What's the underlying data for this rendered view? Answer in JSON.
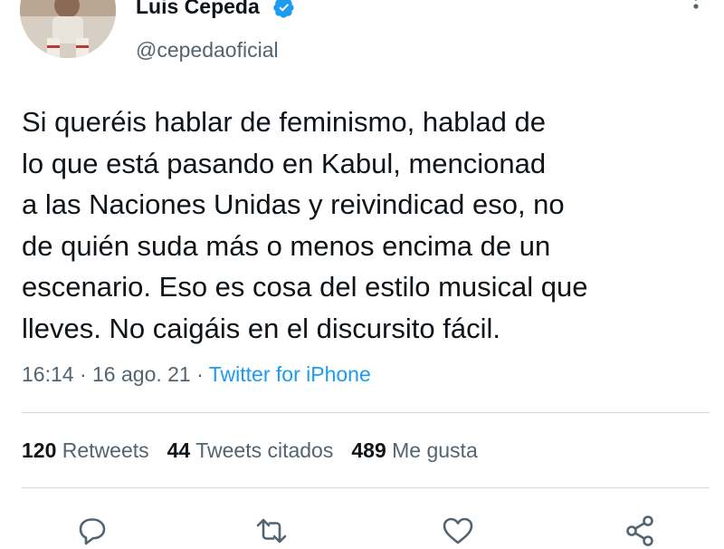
{
  "user": {
    "display_name": "Luis Cepeda",
    "handle": "@cepedaoficial",
    "avatar_icon": "profile-photo",
    "verified_icon": "verified-badge-icon",
    "verified_color": "#1d9bf0"
  },
  "tweet": {
    "lines": [
      "Si queréis hablar de feminismo, hablad de",
      "lo que está pasando en Kabul, mencionad",
      "a las Naciones Unidas y reivindicad eso, no",
      "de quién suda más o menos encima de un",
      "escenario. Eso es cosa del estilo musical que",
      "lleves. No caigáis en el discursito fácil."
    ],
    "time": "16:14",
    "sep1": "·",
    "date": "16 ago. 21",
    "sep2": "·",
    "source": "Twitter for iPhone"
  },
  "stats": {
    "retweets_count": "120",
    "retweets_label": "Retweets",
    "quotes_count": "44",
    "quotes_label": "Tweets citados",
    "likes_count": "489",
    "likes_label": "Me gusta"
  },
  "actions": [
    "reply-icon",
    "retweet-icon",
    "like-icon",
    "share-icon"
  ],
  "colors": {
    "text": "#0f1419",
    "secondary": "#536471",
    "link": "#1d9bf0",
    "divider": "#cfd9de"
  }
}
